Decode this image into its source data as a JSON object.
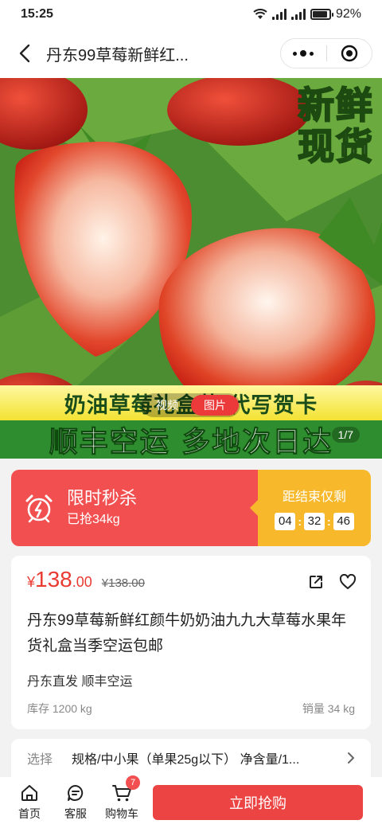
{
  "status_bar": {
    "time": "15:25",
    "battery": "92%",
    "battery_level": 0.92
  },
  "nav": {
    "title": "丹东99草莓新鲜红..."
  },
  "hero": {
    "top_text_line1": "新鲜",
    "top_text_line2": "现货",
    "yellow_band_text": "奶油草莓礼盒装 代写贺卡",
    "green_band_text": "顺丰空运 多地次日达",
    "media_tabs": [
      {
        "label": "视频",
        "active": false
      },
      {
        "label": "图片",
        "active": true
      }
    ],
    "page_indicator": "1/7"
  },
  "flash_sale": {
    "title": "限时秒杀",
    "sold": "已抢34kg",
    "ends_label": "距结束仅剩",
    "countdown": {
      "hours": "04",
      "minutes": "32",
      "seconds": "46"
    }
  },
  "product": {
    "price_symbol": "¥",
    "price_integer": "138",
    "price_decimal": ".00",
    "original_price": "¥138.00",
    "title": "丹东99草莓新鲜红颜牛奶奶油九九大草莓水果年货礼盒当季空运包邮",
    "tags": "丹东直发 顺丰空运",
    "stock": "库存 1200 kg",
    "sales": "销量 34 kg"
  },
  "spec": {
    "label": "选择",
    "value": "规格/中小果（单果25g以下） 净含量/1..."
  },
  "bottom_bar": {
    "home_label": "首页",
    "service_label": "客服",
    "cart_label": "购物车",
    "cart_count": "7",
    "buy_label": "立即抢购"
  },
  "colors": {
    "accent_red": "#ec4343",
    "flash_orange": "#f7b92b",
    "price_red": "#ea3b32"
  }
}
